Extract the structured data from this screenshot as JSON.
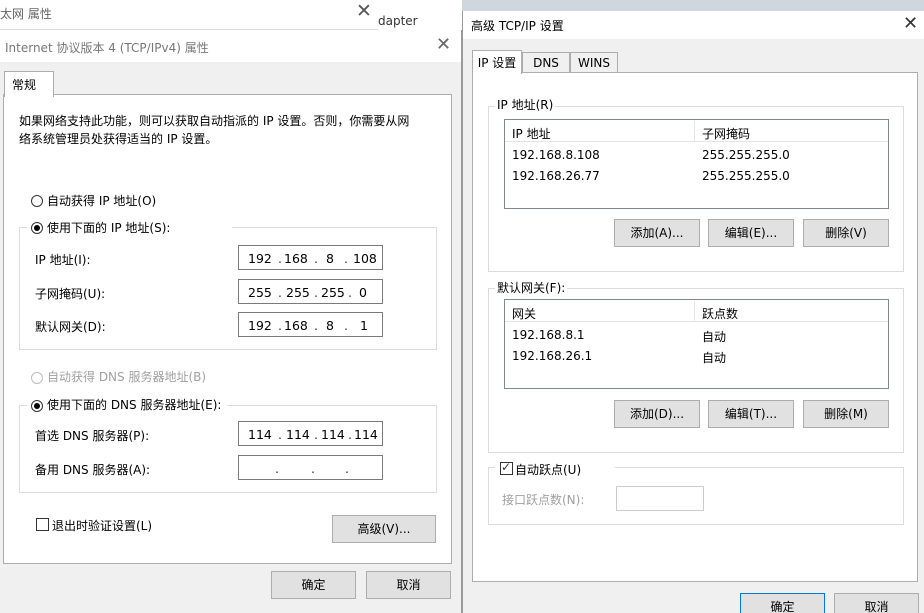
{
  "bg_window": {
    "title": "太网 属性",
    "behind_text": "dapter"
  },
  "left_dialog": {
    "title": "Internet 协议版本 4 (TCP/IPv4) 属性",
    "tab": "常规",
    "description_line1": "如果网络支持此功能，则可以获取自动指派的 IP 设置。否则，你需要从网",
    "description_line2": "络系统管理员处获得适当的 IP 设置。",
    "radio_auto_ip": "自动获得 IP 地址(O)",
    "radio_manual_ip": "使用下面的 IP 地址(S):",
    "ip_label": "IP 地址(I):",
    "ip_value": [
      "192",
      "168",
      "8",
      "108"
    ],
    "subnet_label": "子网掩码(U):",
    "subnet_value": [
      "255",
      "255",
      "255",
      "0"
    ],
    "gateway_label": "默认网关(D):",
    "gateway_value": [
      "192",
      "168",
      "8",
      "1"
    ],
    "radio_auto_dns": "自动获得 DNS 服务器地址(B)",
    "radio_manual_dns": "使用下面的 DNS 服务器地址(E):",
    "dns_preferred_label": "首选 DNS 服务器(P):",
    "dns_preferred_value": [
      "114",
      "114",
      "114",
      "114"
    ],
    "dns_alternate_label": "备用 DNS 服务器(A):",
    "dns_alternate_value": [
      "",
      "",
      "",
      ""
    ],
    "validate_checkbox": "退出时验证设置(L)",
    "advanced_button": "高级(V)...",
    "ok_button": "确定",
    "cancel_button": "取消"
  },
  "right_dialog": {
    "title": "高级 TCP/IP 设置",
    "tabs": [
      "IP 设置",
      "DNS",
      "WINS"
    ],
    "ip_group_title": "IP 地址(R)",
    "ip_headers": [
      "IP 地址",
      "子网掩码"
    ],
    "ip_rows": [
      [
        "192.168.8.108",
        "255.255.255.0"
      ],
      [
        "192.168.26.77",
        "255.255.255.0"
      ]
    ],
    "ip_add_button": "添加(A)...",
    "ip_edit_button": "编辑(E)...",
    "ip_delete_button": "删除(V)",
    "gw_group_title": "默认网关(F):",
    "gw_headers": [
      "网关",
      "跃点数"
    ],
    "gw_rows": [
      [
        "192.168.8.1",
        "自动"
      ],
      [
        "192.168.26.1",
        "自动"
      ]
    ],
    "gw_add_button": "添加(D)...",
    "gw_edit_button": "编辑(T)...",
    "gw_delete_button": "删除(M)",
    "auto_metric_checkbox": "自动跃点(U)",
    "interface_metric_label": "接口跃点数(N):",
    "ok_button": "确定",
    "cancel_button": "取消"
  }
}
